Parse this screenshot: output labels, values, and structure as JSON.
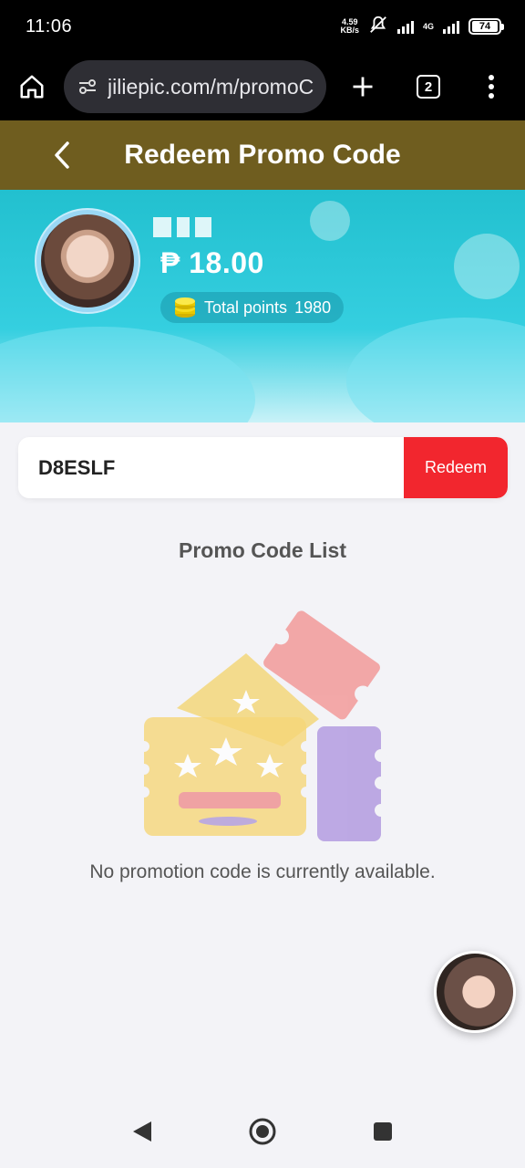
{
  "status_bar": {
    "time": "11:06",
    "net_speed_value": "4.59",
    "net_speed_unit": "KB/s",
    "network_type": "4G",
    "battery": "74"
  },
  "browser": {
    "url": "jiliepic.com/m/promoC",
    "tab_count": "2"
  },
  "header": {
    "title": "Redeem Promo Code"
  },
  "profile": {
    "balance": "₱ 18.00",
    "points_label": "Total points",
    "points_value": "1980"
  },
  "redeem": {
    "code_value": "D8ESLF",
    "button_label": "Redeem"
  },
  "promo_list": {
    "title": "Promo Code List",
    "empty_message": "No promotion code is currently available."
  },
  "colors": {
    "header_bg": "#6f5d1f",
    "hero_bg": "#22c0cf",
    "redeem_button": "#f2262e"
  },
  "icons": {
    "home": "home-icon",
    "site_settings": "tune-icon",
    "new_tab": "plus-icon",
    "tabs": "tabs-icon",
    "menu": "more-vert-icon",
    "back": "chevron-left-icon",
    "coins": "coin-stack-icon"
  }
}
